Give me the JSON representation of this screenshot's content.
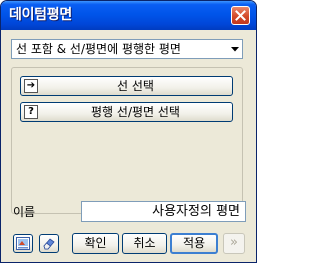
{
  "window": {
    "title": "데이텀평면",
    "close_icon": "close-icon"
  },
  "dropdown": {
    "selected": "선 포함 & 선/평면에 평행한 평면"
  },
  "group": {
    "buttons": [
      {
        "label": "선 선택",
        "icon": "arrow-right-icon",
        "icon_glyph": "➔"
      },
      {
        "label": "평행 선/평면 선택",
        "icon": "question-icon",
        "icon_glyph": "?"
      }
    ]
  },
  "name": {
    "label": "이름",
    "value": "사용자정의 평면"
  },
  "footer": {
    "ok_label": "확인",
    "cancel_label": "취소",
    "apply_label": "적용",
    "more_label": "»"
  },
  "colors": {
    "title_bar": "#0055ea",
    "close_button": "#d34a2a",
    "dialog_bg": "#ece9d8",
    "button_border": "#003c74",
    "default_button_border": "#3c7fd1"
  }
}
